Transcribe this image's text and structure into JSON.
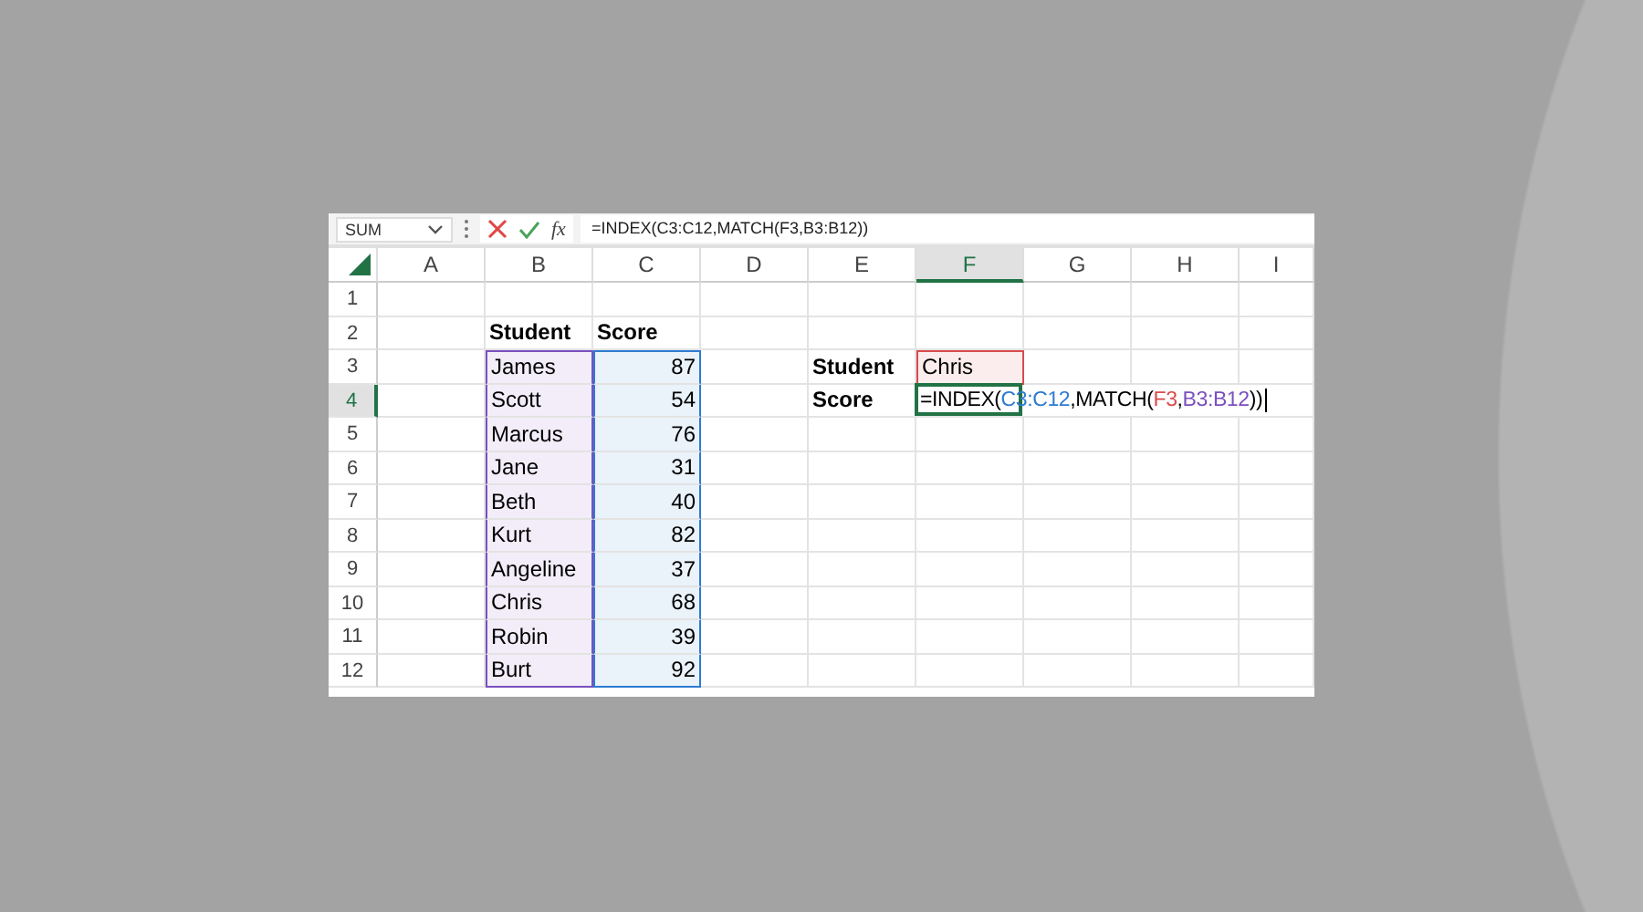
{
  "toolbar": {
    "name_box": "SUM",
    "function_label": "fx",
    "formula": "=INDEX(C3:C12,MATCH(F3,B3:B12))"
  },
  "columns": [
    {
      "label": "A",
      "selected": false
    },
    {
      "label": "B",
      "selected": false
    },
    {
      "label": "C",
      "selected": false
    },
    {
      "label": "D",
      "selected": false
    },
    {
      "label": "E",
      "selected": false
    },
    {
      "label": "F",
      "selected": true
    },
    {
      "label": "G",
      "selected": false
    },
    {
      "label": "H",
      "selected": false
    },
    {
      "label": "I",
      "selected": false
    }
  ],
  "rows": [
    {
      "label": "1",
      "selected": false,
      "cells": [
        null,
        null,
        null,
        null,
        null,
        null,
        null,
        null,
        null
      ]
    },
    {
      "label": "2",
      "selected": false,
      "cells": [
        null,
        {
          "kind": "header",
          "text": "Student"
        },
        {
          "kind": "header",
          "text": "Score"
        },
        null,
        null,
        null,
        null,
        null,
        null
      ]
    },
    {
      "label": "3",
      "selected": false,
      "cells": [
        null,
        {
          "kind": "text",
          "text": "James",
          "color": "#7b4fbf"
        },
        {
          "kind": "number",
          "text": "87",
          "color": "#2e7bd1"
        },
        null,
        {
          "kind": "header",
          "text": "Student"
        },
        {
          "kind": "text",
          "text": "Chris",
          "color": "#d94b4b"
        },
        null,
        null,
        null
      ]
    },
    {
      "label": "4",
      "selected": true,
      "cells": [
        null,
        {
          "kind": "text",
          "text": "Scott",
          "color": "#7b4fbf"
        },
        {
          "kind": "number",
          "text": "54",
          "color": "#2e7bd1"
        },
        null,
        {
          "kind": "header",
          "text": "Score"
        },
        {
          "kind": "formula",
          "selected": true,
          "parts": [
            {
              "text": "=INDEX(",
              "color": "#000000"
            },
            {
              "text": "C3:C12",
              "color": "#2e7bd1"
            },
            {
              "text": ",MATCH(",
              "color": "#000000"
            },
            {
              "text": "F3",
              "color": "#d94b4b"
            },
            {
              "text": ",",
              "color": "#000000"
            },
            {
              "text": "B3:B12",
              "color": "#7b4fbf"
            },
            {
              "text": "))",
              "color": "#000000"
            }
          ]
        },
        null,
        null,
        null
      ]
    },
    {
      "label": "5",
      "selected": false,
      "cells": [
        null,
        {
          "kind": "text",
          "text": "Marcus",
          "color": "#7b4fbf"
        },
        {
          "kind": "number",
          "text": "76",
          "color": "#2e7bd1"
        },
        null,
        null,
        null,
        null,
        null,
        null
      ]
    },
    {
      "label": "6",
      "selected": false,
      "cells": [
        null,
        {
          "kind": "text",
          "text": "Jane",
          "color": "#7b4fbf"
        },
        {
          "kind": "number",
          "text": "31",
          "color": "#2e7bd1"
        },
        null,
        null,
        null,
        null,
        null,
        null
      ]
    },
    {
      "label": "7",
      "selected": false,
      "cells": [
        null,
        {
          "kind": "text",
          "text": "Beth",
          "color": "#7b4fbf"
        },
        {
          "kind": "number",
          "text": "40",
          "color": "#2e7bd1"
        },
        null,
        null,
        null,
        null,
        null,
        null
      ]
    },
    {
      "label": "8",
      "selected": false,
      "cells": [
        null,
        {
          "kind": "text",
          "text": "Kurt",
          "color": "#7b4fbf"
        },
        {
          "kind": "number",
          "text": "82",
          "color": "#2e7bd1"
        },
        null,
        null,
        null,
        null,
        null,
        null
      ]
    },
    {
      "label": "9",
      "selected": false,
      "cells": [
        null,
        {
          "kind": "text",
          "text": "Angeline",
          "color": "#7b4fbf"
        },
        {
          "kind": "number",
          "text": "37",
          "color": "#2e7bd1"
        },
        null,
        null,
        null,
        null,
        null,
        null
      ]
    },
    {
      "label": "10",
      "selected": false,
      "cells": [
        null,
        {
          "kind": "text",
          "text": "Chris",
          "color": "#7b4fbf"
        },
        {
          "kind": "number",
          "text": "68",
          "color": "#2e7bd1"
        },
        null,
        null,
        null,
        null,
        null,
        null
      ]
    },
    {
      "label": "11",
      "selected": false,
      "cells": [
        null,
        {
          "kind": "text",
          "text": "Robin",
          "color": "#7b4fbf"
        },
        {
          "kind": "number",
          "text": "39",
          "color": "#2e7bd1"
        },
        null,
        null,
        null,
        null,
        null,
        null
      ]
    },
    {
      "label": "12",
      "selected": false,
      "cells": [
        null,
        {
          "kind": "text",
          "text": "Burt",
          "color": "#7b4fbf"
        },
        {
          "kind": "number",
          "text": "92",
          "color": "#2e7bd1"
        },
        null,
        null,
        null,
        null,
        null,
        null
      ]
    }
  ]
}
